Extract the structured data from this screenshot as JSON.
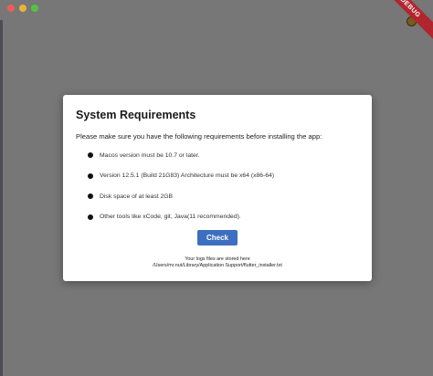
{
  "window": {
    "traffic_lights": [
      "close",
      "minimize",
      "zoom"
    ],
    "debug_banner": "DEBUG"
  },
  "dialog": {
    "title": "System Requirements",
    "intro": "Please make sure you have the following requirements before installing the app:",
    "requirements": [
      "Macos version must be 10.7 or later.",
      "Version 12.5.1 (Build 21G83) Architecture must be x64 (x86-64)",
      "Disk space of at least 2GB",
      "Other tools like xCode, git, Java(11 recommended)."
    ],
    "check_label": "Check",
    "logs_label": "Your logs files are stored here",
    "logs_path": "/Users/mr.nut/Library/Application Support/flutter_installer.txt"
  },
  "colors": {
    "overlay": "#777778",
    "button": "#3d6fc1",
    "debug_banner": "#b1262e"
  }
}
